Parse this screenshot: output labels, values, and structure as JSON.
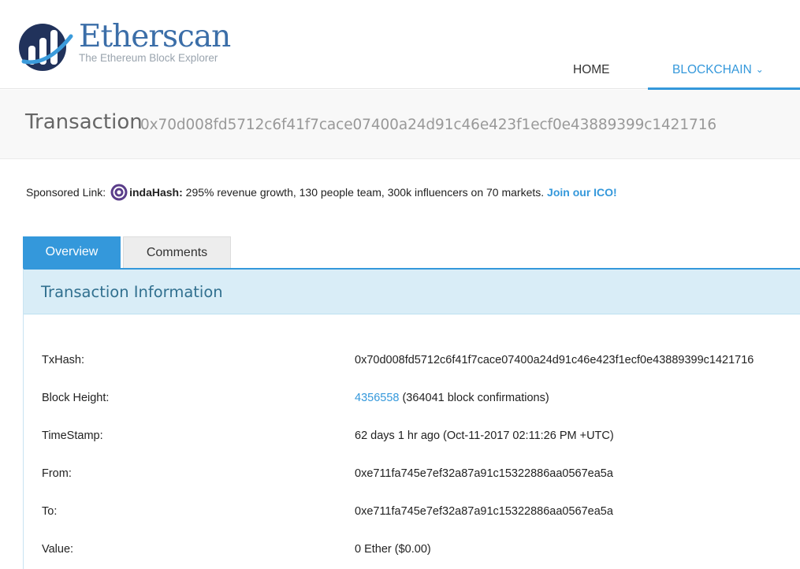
{
  "brand": {
    "name": "Etherscan",
    "tagline": "The Ethereum Block Explorer",
    "colors": {
      "primary": "#3b6ea8",
      "accent": "#3498db"
    }
  },
  "nav": {
    "home": "HOME",
    "blockchain": "BLOCKCHAIN",
    "blockchain_chevron": "⌄"
  },
  "page": {
    "title": "Transaction",
    "hash": "0x70d008fd5712c6f41f7cace07400a24d91c46e423f1ecf0e43889399c1421716"
  },
  "sponsor": {
    "prefix": "Sponsored Link:",
    "brand": "indaHash:",
    "text": " 295% revenue growth, 130 people team, 300k influencers on 70 markets. ",
    "cta": "Join our ICO!"
  },
  "tabs": [
    {
      "label": "Overview",
      "active": true
    },
    {
      "label": "Comments",
      "active": false
    }
  ],
  "panel": {
    "title": "Transaction Information",
    "rows": [
      {
        "key": "TxHash:",
        "value": "0x70d008fd5712c6f41f7cace07400a24d91c46e423f1ecf0e43889399c1421716"
      },
      {
        "key": "Block Height:",
        "link": "4356558",
        "value": " (364041 block confirmations)"
      },
      {
        "key": "TimeStamp:",
        "value": "62 days 1 hr ago (Oct-11-2017 02:11:26 PM +UTC)"
      },
      {
        "key": "From:",
        "link": "0xe711fa745e7ef32a87a91c15322886aa0567ea5a"
      },
      {
        "key": "To:",
        "link": "0xe711fa745e7ef32a87a91c15322886aa0567ea5a"
      },
      {
        "key": "Value:",
        "value": "0 Ether ($0.00)"
      }
    ]
  }
}
